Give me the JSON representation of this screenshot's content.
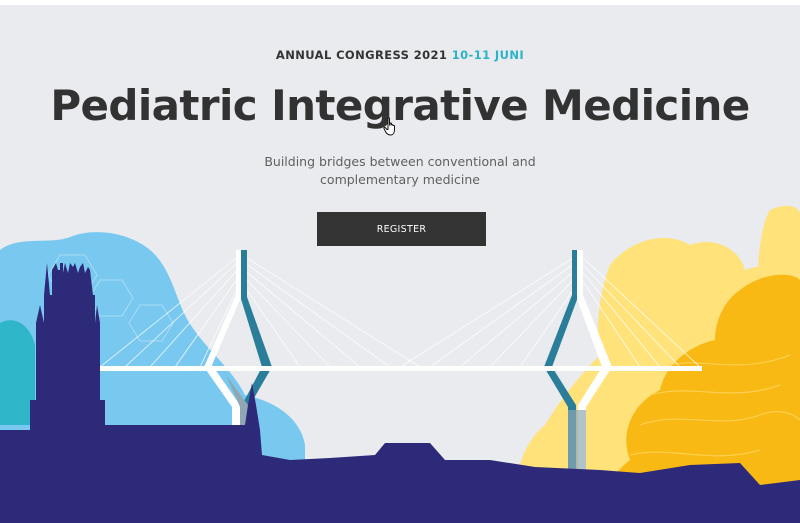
{
  "event": {
    "label": "ANNUAL CONGRESS 2021",
    "dates": "10-11 JUNI",
    "title": "Pediatric Integrative Medicine",
    "subtitle_line1": "Building bridges between conventional and",
    "subtitle_line2": "complementary medicine"
  },
  "actions": {
    "register_label": "REGISTER"
  },
  "colors": {
    "background": "#e9ebee",
    "accent": "#2bb3c9",
    "title": "#323232",
    "button": "#333333",
    "skyline": "#2e2a7a",
    "blue_tree": "#79c8ef",
    "teal_tree": "#2fb6c8",
    "yellow_tree": "#f9b915",
    "light_yellow_tree": "#ffe27a",
    "bridge_pylon": "#2a7e99"
  },
  "icons": {
    "cursor": "hand-pointer-icon"
  }
}
